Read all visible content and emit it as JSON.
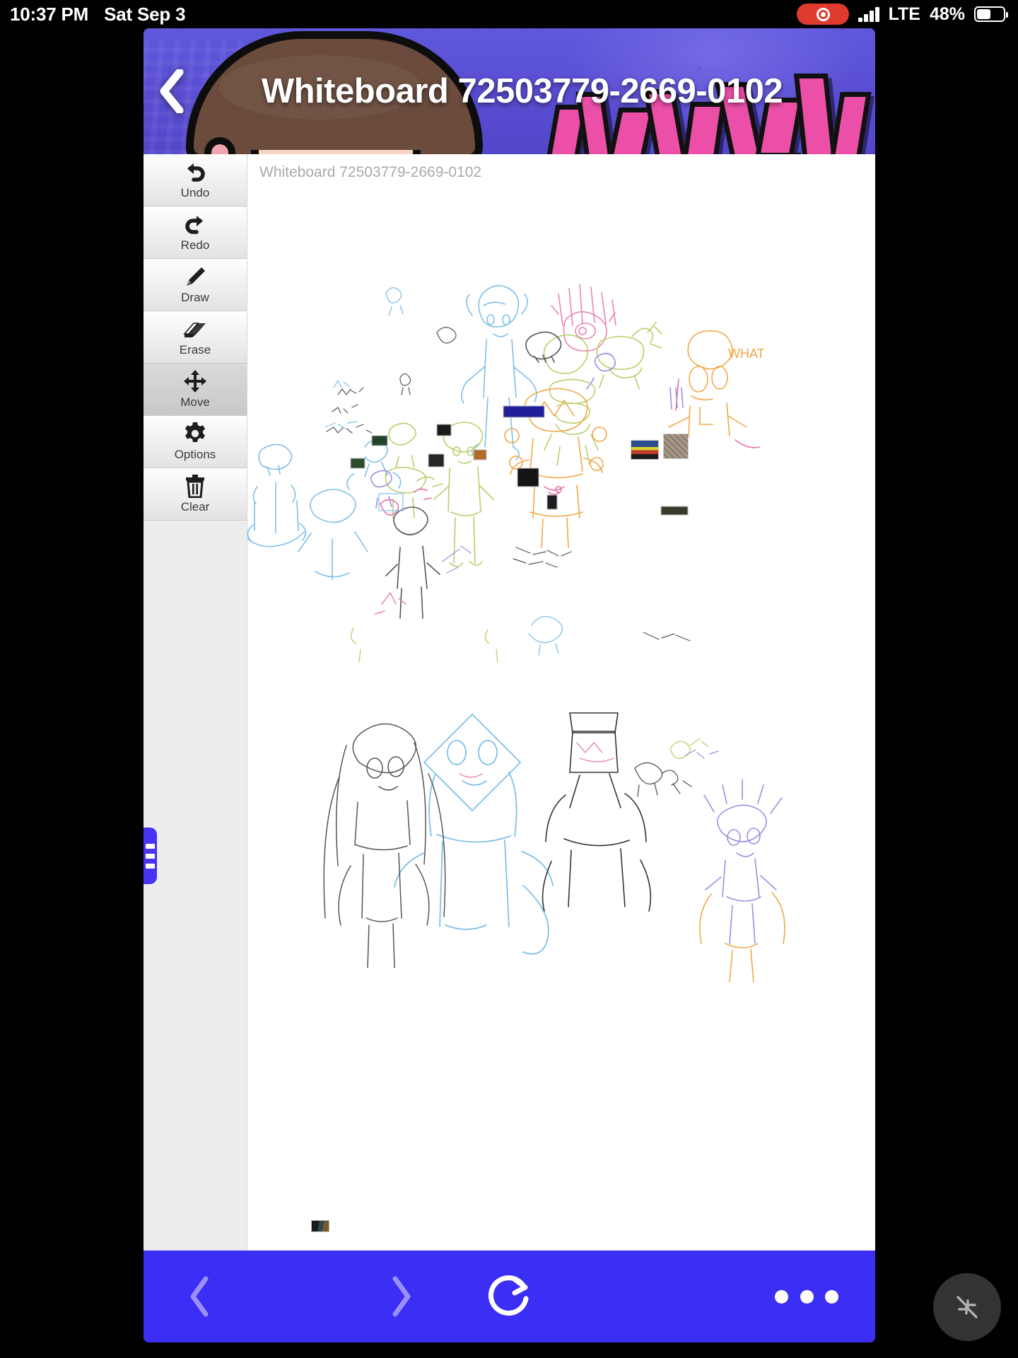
{
  "status_bar": {
    "time": "10:37 PM",
    "date": "Sat Sep 3",
    "recording_icon": "record-indicator",
    "signal_icon": "cellular-bars",
    "network": "LTE",
    "battery_percent": "48%",
    "battery_icon": "battery-half",
    "colors": {
      "record_red": "#e0392e",
      "text": "#ffffff"
    }
  },
  "header": {
    "title": "Whiteboard 72503779-2669-0102",
    "back_icon": "back-chevron-icon",
    "banner_alt": "friday-night-funkin-banner",
    "colors": {
      "banner_bg": "#5a4fd4",
      "graffiti_pink": "#ec4fa8",
      "hair": "#6b4b3c",
      "skin": "#f7d6c4"
    }
  },
  "sidebar": {
    "tools": [
      {
        "label": "Undo",
        "icon": "undo-arrow-icon",
        "selected": false
      },
      {
        "label": "Redo",
        "icon": "redo-arrow-icon",
        "selected": false
      },
      {
        "label": "Draw",
        "icon": "pencil-icon",
        "selected": false
      },
      {
        "label": "Erase",
        "icon": "eraser-icon",
        "selected": false
      },
      {
        "label": "Move",
        "icon": "move-arrows-icon",
        "selected": true
      },
      {
        "label": "Options",
        "icon": "gear-icon",
        "selected": false
      },
      {
        "label": "Clear",
        "icon": "trash-can-icon",
        "selected": false
      }
    ],
    "drawer_handle_icon": "hamburger-handle-icon",
    "colors": {
      "bg": "#ededed",
      "button_top": "#fefefe",
      "button_bottom": "#e3e3e3",
      "selected": "#d2d2d2"
    }
  },
  "canvas": {
    "label": "Whiteboard 72503779-2669-0102",
    "description": "collaborative whiteboard with many small multi-color sketch drawings and a few embedded photos",
    "embedded_photos": 3,
    "sketch_colors": [
      "#7ec0e8",
      "#b8cf6a",
      "#f0a84a",
      "#e86fa8",
      "#9b8fe0",
      "#555555"
    ]
  },
  "bottom_bar": {
    "back_icon": "chevron-left-icon",
    "forward_icon": "chevron-right-icon",
    "reload_icon": "reload-circular-arrow-icon",
    "more_icon": "three-dots-icon",
    "colors": {
      "bg": "#3b2ef5",
      "icon": "#ffffff",
      "icon_disabled": "#9a90f7"
    }
  },
  "floating_button": {
    "icon": "minimize-arrows-icon",
    "color": "#333333"
  }
}
